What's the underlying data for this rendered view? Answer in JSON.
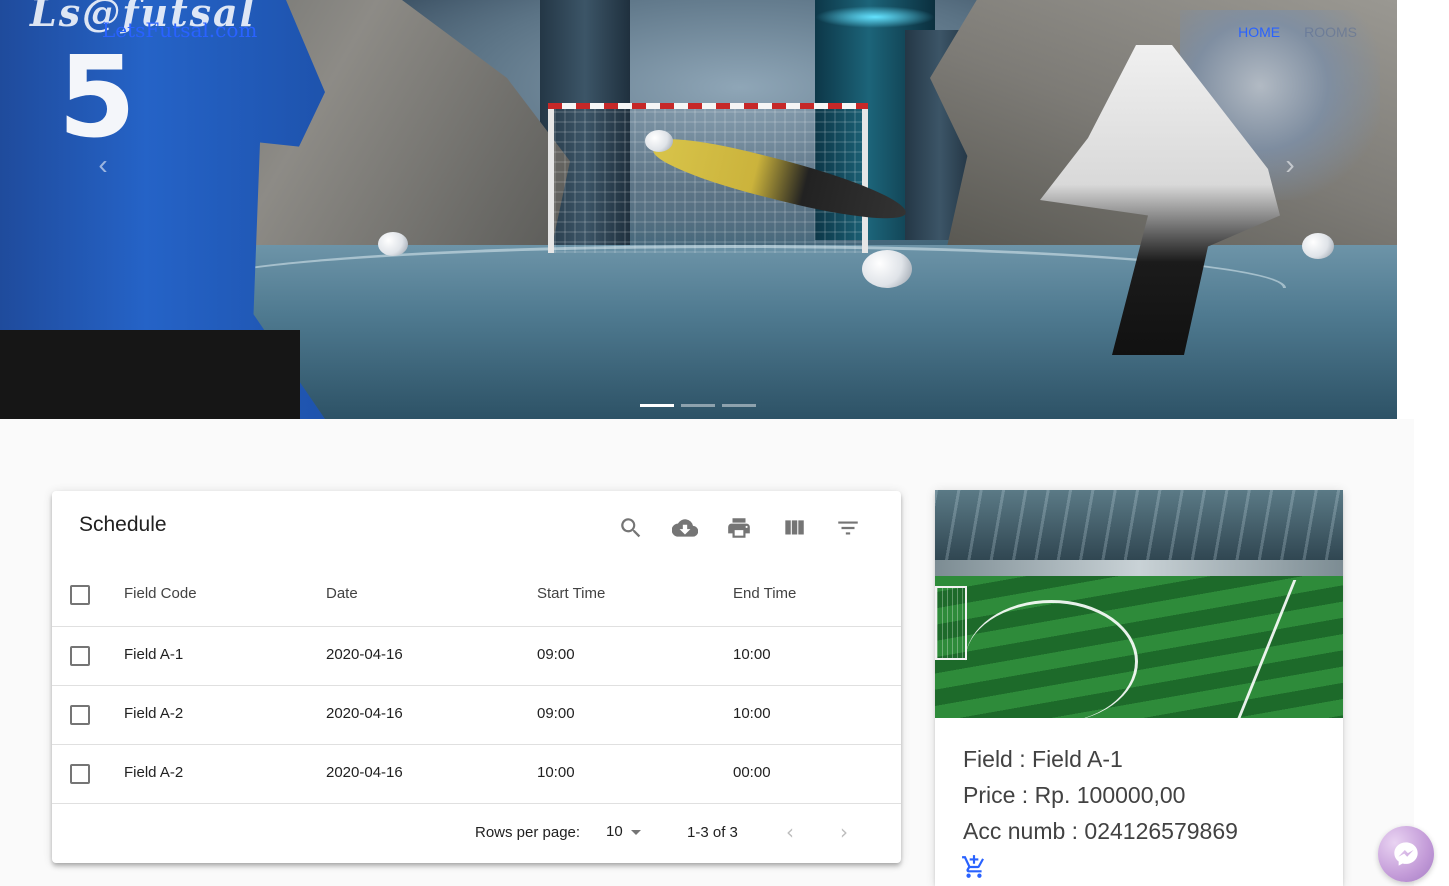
{
  "hero": {
    "brand": "LetsFutsal.com",
    "logo_text": "Ls@futsal",
    "jersey_number": "5",
    "nav": [
      "HOME",
      "ROOMS"
    ],
    "prev_icon": "chevron-left",
    "next_icon": "chevron-right",
    "slides": 3,
    "active_slide": 1
  },
  "schedule": {
    "title": "Schedule",
    "toolbar_icons": [
      "search-icon",
      "cloud-download-icon",
      "print-icon",
      "view-columns-icon",
      "filter-icon"
    ],
    "columns": [
      "Field Code",
      "Date",
      "Start Time",
      "End Time"
    ],
    "rows": [
      [
        "Field A-1",
        "2020-04-16",
        "09:00",
        "10:00"
      ],
      [
        "Field A-2",
        "2020-04-16",
        "09:00",
        "10:00"
      ],
      [
        "Field A-2",
        "2020-04-16",
        "10:00",
        "00:00"
      ]
    ],
    "footer": {
      "rows_per_page_label": "Rows per page:",
      "rows_per_page_value": "10",
      "range": "1-3 of 3"
    }
  },
  "field_card": {
    "field": "Field : Field A-1",
    "price": "Price : Rp. 100000,00",
    "account": "Acc numb : 024126579869",
    "cart_icon": "add-shopping-cart-icon"
  },
  "colors": {
    "accent": "#2962ff",
    "icon_gray": "#757575",
    "divider": "#e0e0e0",
    "messenger": "#c39bd8"
  }
}
